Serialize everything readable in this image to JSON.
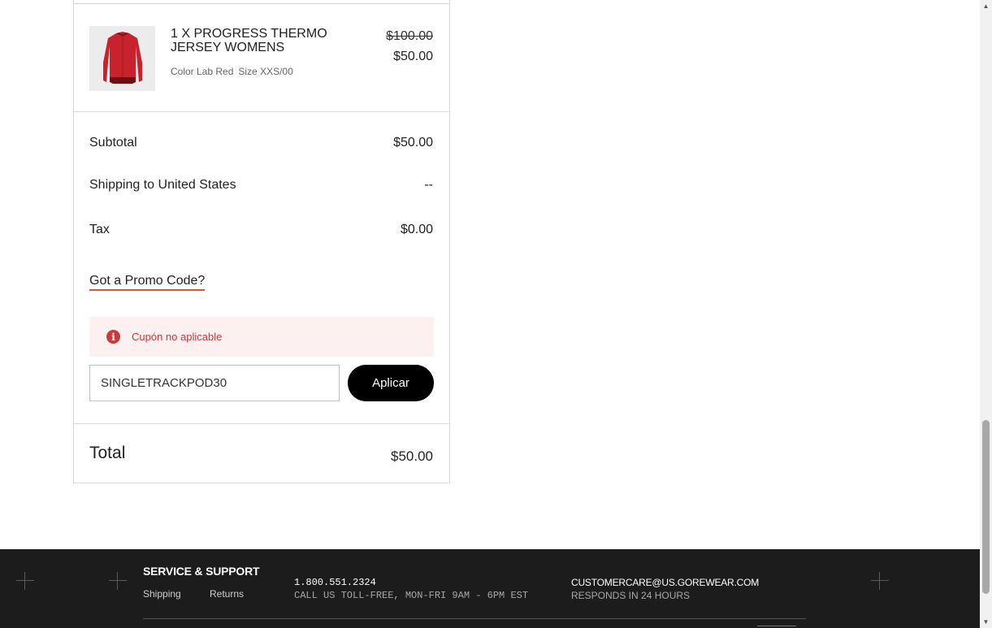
{
  "item": {
    "title": "1 X PROGRESS THERMO JERSEY WOMENS",
    "color": "Color Lab Red",
    "size": "Size XXS/00",
    "original_price": "$100.00",
    "sale_price": "$50.00",
    "image_icon": "jersey-icon"
  },
  "summary": {
    "subtotal_label": "Subtotal",
    "subtotal_value": "$50.00",
    "shipping_label": "Shipping to United States",
    "shipping_value": "--",
    "tax_label": "Tax",
    "tax_value": "$0.00",
    "total_label": "Total",
    "total_value": "$50.00"
  },
  "promo": {
    "link_label": "Got a Promo Code?",
    "error_message": "Cupón no aplicable",
    "error_icon": "info-icon",
    "input_value": "SINGLETRACKPOD30",
    "apply_label": "Aplicar"
  },
  "footer": {
    "section_title": "SERVICE & SUPPORT",
    "links": [
      "Shipping",
      "Returns"
    ],
    "phone": "1.800.551.2324",
    "phone_note": "CALL US TOLL-FREE, MON-FRI 9AM - 6PM EST",
    "email": "CUSTOMERCARE@US.GOREWEAR.COM",
    "email_note": "RESPONDS IN 24 HOURS"
  },
  "colors": {
    "accent_underline": "#e0532c",
    "error_text": "#c63b3b",
    "error_bg": "#fdf0f0",
    "button_bg": "#000000",
    "footer_bg": "#1c1c1c",
    "jersey_red": "#c8232c"
  }
}
